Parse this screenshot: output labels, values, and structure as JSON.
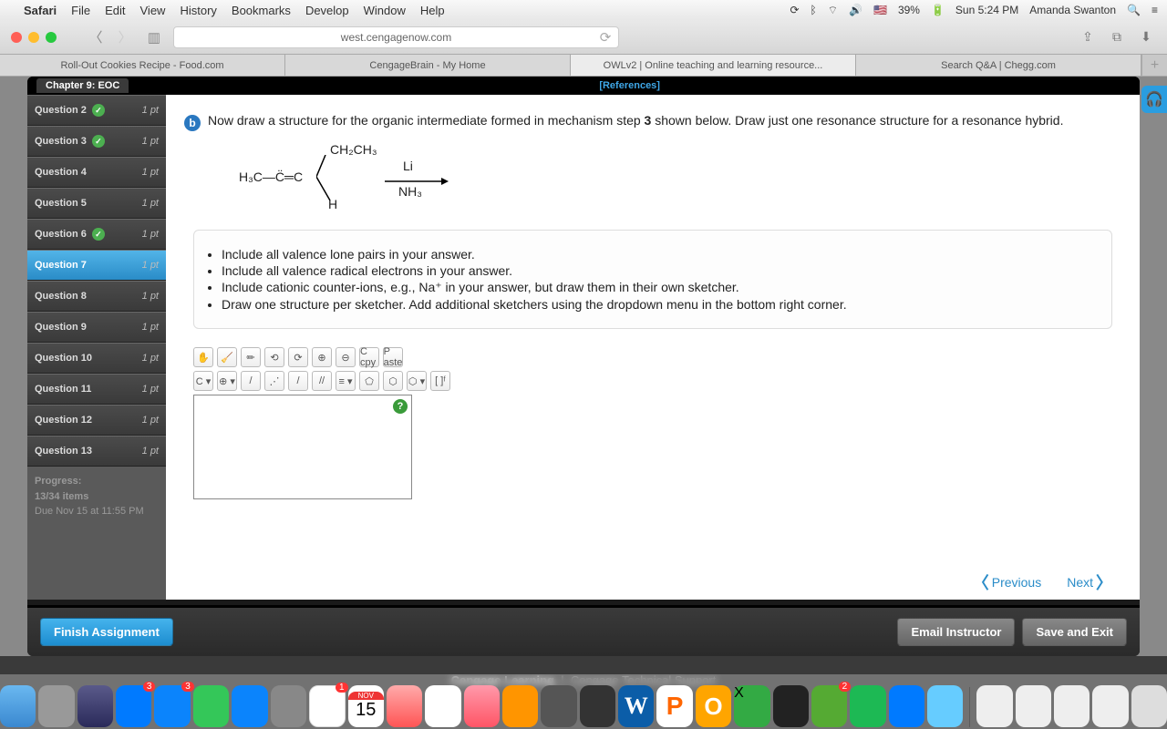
{
  "menubar": {
    "app": "Safari",
    "items": [
      "File",
      "Edit",
      "View",
      "History",
      "Bookmarks",
      "Develop",
      "Window",
      "Help"
    ],
    "battery": "39%",
    "clock": "Sun 5:24 PM",
    "user": "Amanda Swanton"
  },
  "browser": {
    "url": "west.cengagenow.com",
    "tabs": [
      "Roll-Out Cookies Recipe - Food.com",
      "CengageBrain - My Home",
      "OWLv2 | Online teaching and learning resource...",
      "Search Q&A | Chegg.com"
    ],
    "active_tab": 2
  },
  "app": {
    "chapter": "Chapter 9: EOC",
    "references": "[References]",
    "questions": [
      {
        "label": "Question 2",
        "pts": "1 pt",
        "done": true
      },
      {
        "label": "Question 3",
        "pts": "1 pt",
        "done": true
      },
      {
        "label": "Question 4",
        "pts": "1 pt",
        "done": false
      },
      {
        "label": "Question 5",
        "pts": "1 pt",
        "done": false
      },
      {
        "label": "Question 6",
        "pts": "1 pt",
        "done": true
      },
      {
        "label": "Question 7",
        "pts": "1 pt",
        "done": false,
        "selected": true
      },
      {
        "label": "Question 8",
        "pts": "1 pt",
        "done": false
      },
      {
        "label": "Question 9",
        "pts": "1 pt",
        "done": false
      },
      {
        "label": "Question 10",
        "pts": "1 pt",
        "done": false
      },
      {
        "label": "Question 11",
        "pts": "1 pt",
        "done": false
      },
      {
        "label": "Question 12",
        "pts": "1 pt",
        "done": false
      },
      {
        "label": "Question 13",
        "pts": "1 pt",
        "done": false
      }
    ],
    "progress": {
      "label": "Progress:",
      "count": "13/34 items",
      "due": "Due Nov 15 at 11:55 PM"
    },
    "part": {
      "letter": "b",
      "prompt_before": "Now draw a structure for the organic intermediate formed in mechanism step ",
      "step": "3",
      "prompt_after": " shown below. Draw just one resonance structure for a resonance hybrid."
    },
    "reaction": {
      "left": "H₃C—C̈═C",
      "branch": "CH₂CH₃",
      "h": "H",
      "reagent_top": "Li",
      "reagent_bot": "NH₃"
    },
    "instructions": [
      "Include all valence lone pairs in your answer.",
      "Include all valence radical electrons in your answer.",
      "Include cationic counter-ions, e.g., Na⁺ in your answer, but draw them in their own sketcher.",
      "Draw one structure per sketcher. Add additional sketchers using the dropdown menu in the bottom right corner."
    ],
    "sketcher_tools_row1": [
      "✋",
      "🧹",
      "✏",
      "⟲",
      "⟳",
      "⊕",
      "⊖",
      "C cpy",
      "P aste"
    ],
    "sketcher_tools_row2": [
      "C ▾",
      "⊕ ▾",
      "/",
      "⋰",
      "/",
      "//",
      "≡ ▾",
      "⬠",
      "⬡",
      "⬡ ▾",
      "[ ]ᶠ"
    ],
    "nav": {
      "prev": "Previous",
      "next": "Next"
    },
    "buttons": {
      "finish": "Finish Assignment",
      "email": "Email Instructor",
      "save": "Save and Exit"
    }
  },
  "footer": {
    "brand": "Cengage Learning",
    "link": "Cengage Technical Support"
  },
  "dock": {
    "cal_month": "NOV",
    "cal_day": "15"
  }
}
